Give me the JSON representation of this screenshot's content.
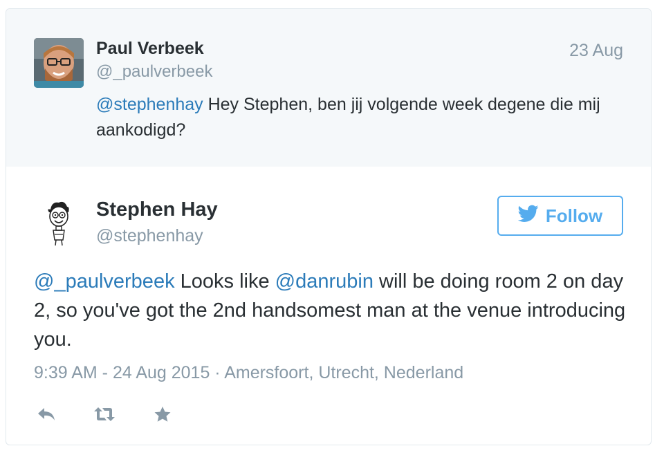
{
  "parent_tweet": {
    "name": "Paul Verbeek",
    "handle": "@_paulverbeek",
    "date": "23 Aug",
    "text_mention": "@stephenhay",
    "text_rest": " Hey Stephen, ben jij volgende week degene die mij aankodigd?"
  },
  "main_tweet": {
    "name": "Stephen Hay",
    "handle": "@stephenhay",
    "follow_label": "Follow",
    "text": {
      "mention1": "@_paulverbeek",
      "part1": " Looks like ",
      "mention2": "@danrubin",
      "part2": " will be doing room 2 on day 2, so you've got the 2nd handsomest man at the venue introducing you."
    },
    "meta": "9:39 AM - 24 Aug 2015 · Amersfoort, Utrecht, Nederland"
  },
  "actions": [
    {
      "icon": "reply-icon"
    },
    {
      "icon": "retweet-icon"
    },
    {
      "icon": "favorite-star-icon"
    }
  ],
  "colors": {
    "link": "#2b7bb9",
    "twitter_blue": "#55acee",
    "muted": "#8899a6",
    "parent_bg": "#f5f8fa"
  }
}
